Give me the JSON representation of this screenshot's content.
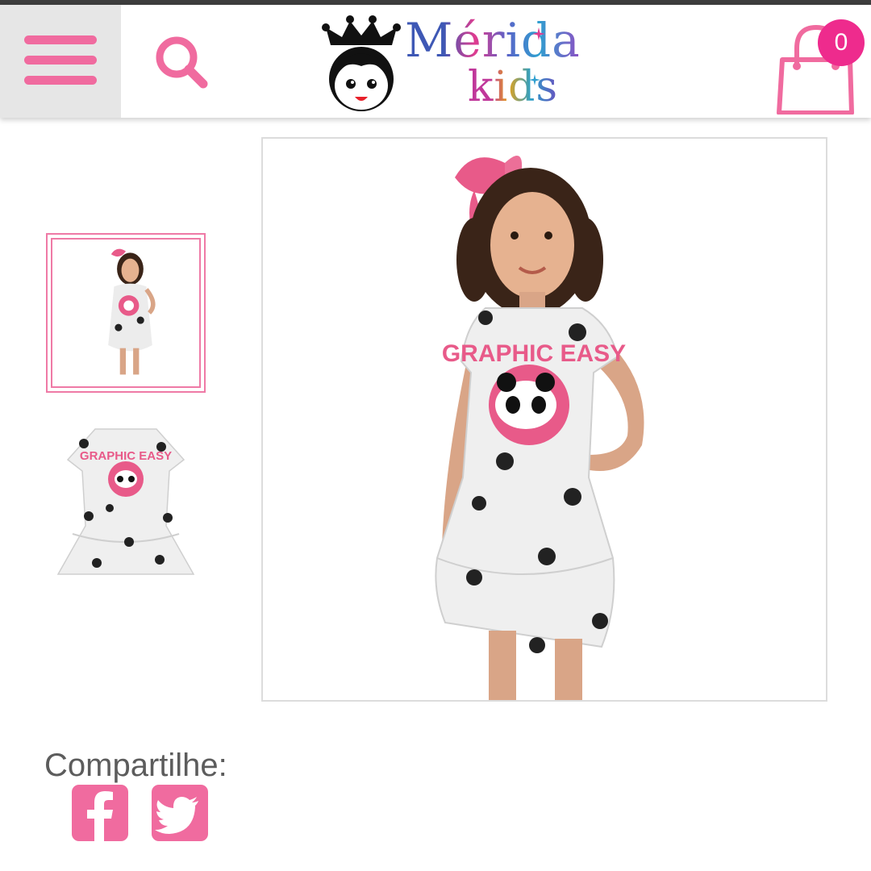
{
  "brand": {
    "name_line1": "Mérida",
    "name_line2": "kids",
    "accent_color": "#f06b9f",
    "badge_color": "#ee2b8d"
  },
  "header": {
    "menu_icon": "hamburger-menu-icon",
    "search_icon": "search-icon",
    "cart_icon": "shopping-bag-icon",
    "cart_count": "0"
  },
  "gallery": {
    "selected_index": 0,
    "thumbnails": [
      {
        "kind": "photo-girl-wearing-dress",
        "selected": true
      },
      {
        "kind": "photo-dress-only",
        "selected": false
      }
    ],
    "dress_print_text": "GRAPHIC EASY"
  },
  "share": {
    "label": "Compartilhe:",
    "networks": [
      {
        "icon": "facebook-icon"
      },
      {
        "icon": "twitter-icon"
      }
    ]
  }
}
